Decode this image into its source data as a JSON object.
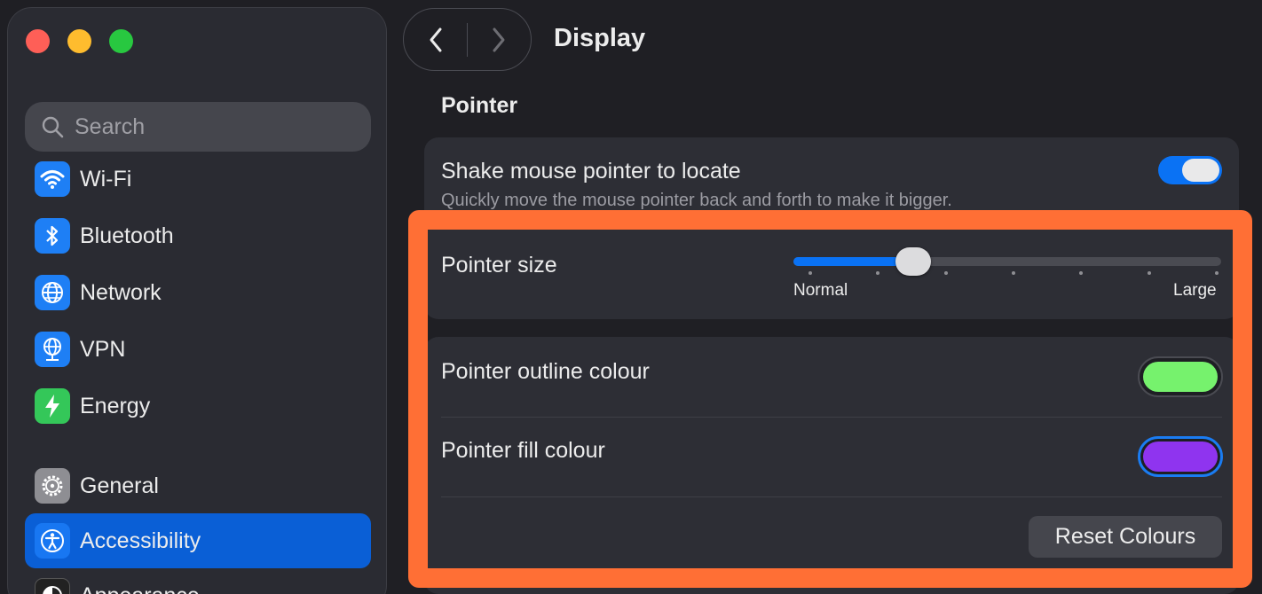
{
  "window": {
    "title": "Display"
  },
  "sidebar": {
    "search_placeholder": "Search",
    "items": [
      {
        "label": "Wi-Fi",
        "icon": "wifi-icon"
      },
      {
        "label": "Bluetooth",
        "icon": "bluetooth-icon"
      },
      {
        "label": "Network",
        "icon": "globe-icon"
      },
      {
        "label": "VPN",
        "icon": "vpn-globe-icon"
      },
      {
        "label": "Energy",
        "icon": "lightning-icon"
      },
      {
        "label": "General",
        "icon": "gear-icon"
      },
      {
        "label": "Accessibility",
        "icon": "accessibility-icon",
        "selected": true
      },
      {
        "label": "Appearance",
        "icon": "appearance-icon"
      }
    ]
  },
  "pointer": {
    "section_title": "Pointer",
    "shake": {
      "label": "Shake mouse pointer to locate",
      "description": "Quickly move the mouse pointer back and forth to make it bigger.",
      "enabled": true
    },
    "size": {
      "label": "Pointer size",
      "min_label": "Normal",
      "max_label": "Large",
      "value_fraction": 0.28,
      "ticks": 7
    },
    "outline": {
      "label": "Pointer outline colour",
      "color": "#76f26d"
    },
    "fill": {
      "label": "Pointer fill colour",
      "color": "#8f34ef"
    },
    "reset_label": "Reset Colours"
  },
  "colors": {
    "accent": "#0a72f4",
    "highlight": "#ff6f35",
    "selected_sidebar": "#0a5fd6"
  }
}
